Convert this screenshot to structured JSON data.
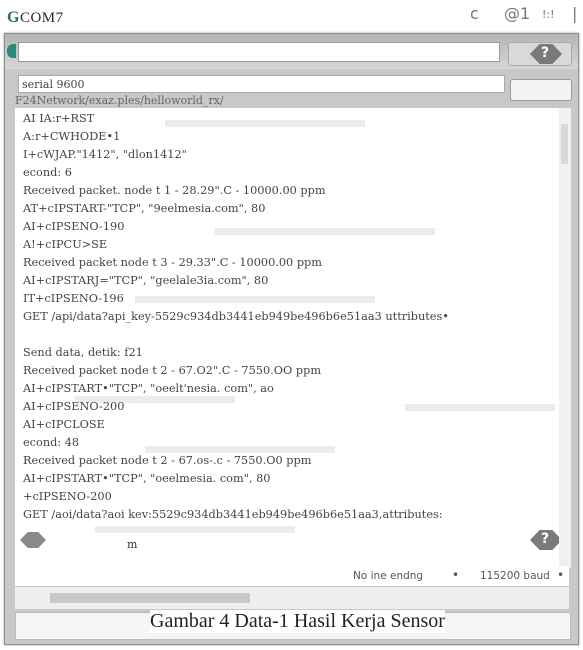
{
  "app": {
    "title_initial": "G",
    "title_rest": "COM7",
    "win_controls": [
      "c",
      "@1",
      "!:!",
      "|"
    ]
  },
  "toolbar": {
    "help_icon": "question-diamond",
    "help_glyph": "?"
  },
  "serial": {
    "text": "serial 9600"
  },
  "path": {
    "text": "F24Network/exaz.ples/helloworld_rx/"
  },
  "log_lines": [
    "AI IA:r+RST",
    "A:r+CWHODE•1",
    "I+cWJAP.\"1412\", \"dlon1412\"",
    "econd:  6",
    "Received packet. node t 1 - 28.29\".C - 10000.00 ppm",
    "AT+cIPSTART-\"TCP\", \"9eelmesia.com\", 80",
    "AI+cIPSENO-190",
    "A!+cIPCU>SE",
    "Received packet node t 3 - 29.33\".C - 10000.00 ppm",
    "AI+cIPSTARJ=\"TCP\", \"geelale3ia.com\", 80",
    "IT+cIPSENO-196",
    "GET /api/data?api_key-5529c934db3441eb949be496b6e51aa3 uttributes•",
    "",
    "Send data, detik: f21",
    "Received packet node t 2 - 67.O2\".C - 7550.OO ppm",
    "AI+cIPSTART•\"TCP\", \"oeelt'nesia. com\", ao",
    "AI+cIPSENO-200",
    "AI+cIPCLOSE",
    "econd:  48",
    "Received packet node t 2 - 67.os-.c - 7550.O0 ppm",
    "AI+cIPSTART•\"TCP\", \"oeelmesia. com\", 80",
    "+cIPSENO-200",
    "GET /aoi/data?aoi kev:5529c934db3441eb949be496b6e51aa3,attributes:"
  ],
  "footer": {
    "m_char": "m",
    "line_ending": "No ine endng",
    "baud": "115200 baud"
  },
  "caption": {
    "text": "Gambar 4 Data-1 Hasil Kerja Sensor"
  },
  "colors": {
    "accent": "#2a8a7a",
    "frame": "#c8c8c8"
  }
}
